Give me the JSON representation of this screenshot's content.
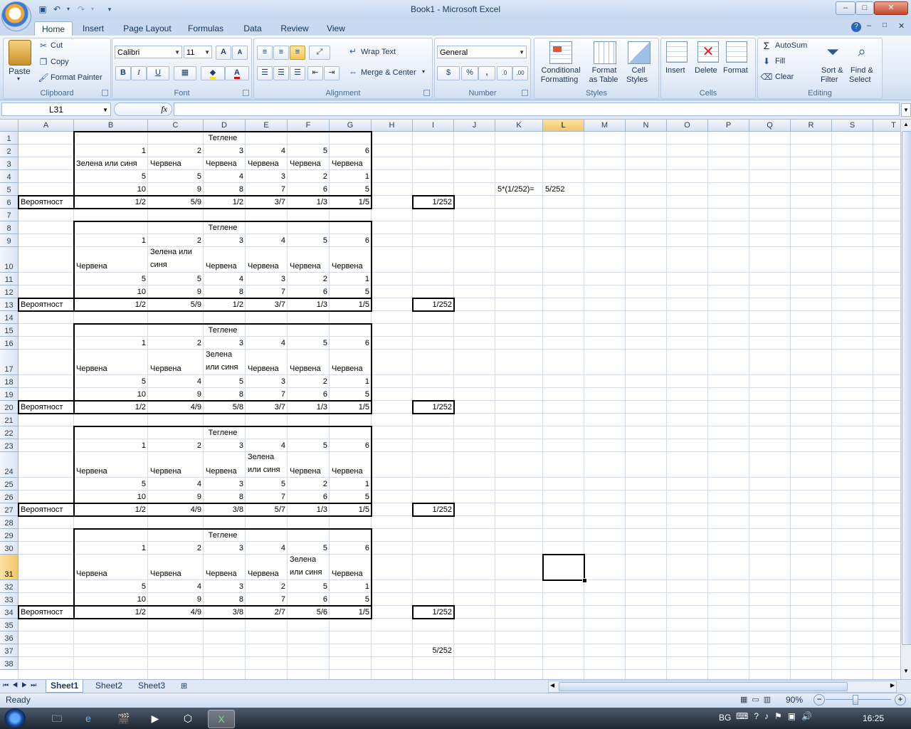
{
  "window": {
    "title": "Book1 - Microsoft Excel",
    "min": "–",
    "max": "□",
    "close": "✕"
  },
  "tabs": [
    "Home",
    "Insert",
    "Page Layout",
    "Formulas",
    "Data",
    "Review",
    "View"
  ],
  "ribbon": {
    "clipboard": {
      "label": "Clipboard",
      "paste": "Paste",
      "cut": "Cut",
      "copy": "Copy",
      "format_painter": "Format Painter"
    },
    "font": {
      "label": "Font",
      "name": "Calibri",
      "size": "11",
      "bold": "B",
      "italic": "I",
      "underline": "U",
      "grow": "A",
      "shrink": "A",
      "font_color_letter": "A"
    },
    "alignment": {
      "label": "Alignment",
      "wrap_text": "Wrap Text",
      "merge_center": "Merge & Center"
    },
    "number": {
      "label": "Number",
      "format": "General",
      "percent": "%",
      "comma": ",",
      "inc_dec": ".0",
      "dec_dec": ".00"
    },
    "styles": {
      "label": "Styles",
      "conditional_1": "Conditional",
      "conditional_2": "Formatting",
      "format_table_1": "Format",
      "format_table_2": "as Table",
      "cell_styles_1": "Cell",
      "cell_styles_2": "Styles"
    },
    "cells": {
      "label": "Cells",
      "insert": "Insert",
      "delete": "Delete",
      "format": "Format"
    },
    "editing": {
      "label": "Editing",
      "autosum": "AutoSum",
      "fill": "Fill",
      "clear": "Clear",
      "sort_1": "Sort &",
      "sort_2": "Filter",
      "find_1": "Find &",
      "find_2": "Select"
    }
  },
  "formula_bar": {
    "name_box": "L31",
    "fx": "fx",
    "formula": ""
  },
  "columns": [
    "A",
    "B",
    "C",
    "D",
    "E",
    "F",
    "G",
    "H",
    "I",
    "J",
    "K",
    "L",
    "M",
    "N",
    "O",
    "P",
    "Q",
    "R",
    "S",
    "T"
  ],
  "rows": [
    "1",
    "2",
    "3",
    "4",
    "5",
    "6",
    "7",
    "8",
    "9",
    "10",
    "11",
    "12",
    "13",
    "14",
    "15",
    "16",
    "17",
    "18",
    "19",
    "20",
    "21",
    "22",
    "23",
    "24",
    "25",
    "26",
    "27",
    "28",
    "29",
    "30",
    "31",
    "32",
    "33",
    "34",
    "35",
    "36",
    "37",
    "38"
  ],
  "cells": [
    {
      "r": 1,
      "c": "D",
      "v": "Теглене",
      "a": "c"
    },
    {
      "r": 2,
      "c": "B",
      "v": "1",
      "a": "r"
    },
    {
      "r": 2,
      "c": "C",
      "v": "2",
      "a": "r"
    },
    {
      "r": 2,
      "c": "D",
      "v": "3",
      "a": "r"
    },
    {
      "r": 2,
      "c": "E",
      "v": "4",
      "a": "r"
    },
    {
      "r": 2,
      "c": "F",
      "v": "5",
      "a": "r"
    },
    {
      "r": 2,
      "c": "G",
      "v": "6",
      "a": "r"
    },
    {
      "r": 3,
      "c": "B",
      "v": "Зелена или синя",
      "a": "l"
    },
    {
      "r": 3,
      "c": "C",
      "v": "Червена",
      "a": "l"
    },
    {
      "r": 3,
      "c": "D",
      "v": "Червена",
      "a": "l"
    },
    {
      "r": 3,
      "c": "E",
      "v": "Червена",
      "a": "l"
    },
    {
      "r": 3,
      "c": "F",
      "v": "Червена",
      "a": "l"
    },
    {
      "r": 3,
      "c": "G",
      "v": "Червена",
      "a": "l"
    },
    {
      "r": 4,
      "c": "B",
      "v": "5",
      "a": "r"
    },
    {
      "r": 4,
      "c": "C",
      "v": "5",
      "a": "r"
    },
    {
      "r": 4,
      "c": "D",
      "v": "4",
      "a": "r"
    },
    {
      "r": 4,
      "c": "E",
      "v": "3",
      "a": "r"
    },
    {
      "r": 4,
      "c": "F",
      "v": "2",
      "a": "r"
    },
    {
      "r": 4,
      "c": "G",
      "v": "1",
      "a": "r"
    },
    {
      "r": 5,
      "c": "B",
      "v": "10",
      "a": "r"
    },
    {
      "r": 5,
      "c": "C",
      "v": "9",
      "a": "r"
    },
    {
      "r": 5,
      "c": "D",
      "v": "8",
      "a": "r"
    },
    {
      "r": 5,
      "c": "E",
      "v": "7",
      "a": "r"
    },
    {
      "r": 5,
      "c": "F",
      "v": "6",
      "a": "r"
    },
    {
      "r": 5,
      "c": "G",
      "v": "5",
      "a": "r"
    },
    {
      "r": 5,
      "c": "K",
      "v": "5*(1/252)=",
      "a": "l"
    },
    {
      "r": 5,
      "c": "L",
      "v": "5/252",
      "a": "l"
    },
    {
      "r": 6,
      "c": "A",
      "v": "Вероятност",
      "a": "l"
    },
    {
      "r": 6,
      "c": "B",
      "v": "1/2",
      "a": "r"
    },
    {
      "r": 6,
      "c": "C",
      "v": "5/9",
      "a": "r"
    },
    {
      "r": 6,
      "c": "D",
      "v": "1/2",
      "a": "r"
    },
    {
      "r": 6,
      "c": "E",
      "v": "3/7",
      "a": "r"
    },
    {
      "r": 6,
      "c": "F",
      "v": "1/3",
      "a": "r"
    },
    {
      "r": 6,
      "c": "G",
      "v": "1/5",
      "a": "r"
    },
    {
      "r": 6,
      "c": "I",
      "v": "1/252",
      "a": "r"
    },
    {
      "r": 8,
      "c": "D",
      "v": "Теглене",
      "a": "c"
    },
    {
      "r": 9,
      "c": "B",
      "v": "1",
      "a": "r"
    },
    {
      "r": 9,
      "c": "C",
      "v": "2",
      "a": "r"
    },
    {
      "r": 9,
      "c": "D",
      "v": "3",
      "a": "r"
    },
    {
      "r": 9,
      "c": "E",
      "v": "4",
      "a": "r"
    },
    {
      "r": 9,
      "c": "F",
      "v": "5",
      "a": "r"
    },
    {
      "r": 9,
      "c": "G",
      "v": "6",
      "a": "r"
    },
    {
      "r": 10,
      "c": "B",
      "v": "Червена",
      "a": "l"
    },
    {
      "r": 10,
      "c": "C",
      "v": "Зелена или синя",
      "a": "w"
    },
    {
      "r": 10,
      "c": "D",
      "v": "Червена",
      "a": "l"
    },
    {
      "r": 10,
      "c": "E",
      "v": "Червена",
      "a": "l"
    },
    {
      "r": 10,
      "c": "F",
      "v": "Червена",
      "a": "l"
    },
    {
      "r": 10,
      "c": "G",
      "v": "Червена",
      "a": "l"
    },
    {
      "r": 11,
      "c": "B",
      "v": "5",
      "a": "r"
    },
    {
      "r": 11,
      "c": "C",
      "v": "5",
      "a": "r"
    },
    {
      "r": 11,
      "c": "D",
      "v": "4",
      "a": "r"
    },
    {
      "r": 11,
      "c": "E",
      "v": "3",
      "a": "r"
    },
    {
      "r": 11,
      "c": "F",
      "v": "2",
      "a": "r"
    },
    {
      "r": 11,
      "c": "G",
      "v": "1",
      "a": "r"
    },
    {
      "r": 12,
      "c": "B",
      "v": "10",
      "a": "r"
    },
    {
      "r": 12,
      "c": "C",
      "v": "9",
      "a": "r"
    },
    {
      "r": 12,
      "c": "D",
      "v": "8",
      "a": "r"
    },
    {
      "r": 12,
      "c": "E",
      "v": "7",
      "a": "r"
    },
    {
      "r": 12,
      "c": "F",
      "v": "6",
      "a": "r"
    },
    {
      "r": 12,
      "c": "G",
      "v": "5",
      "a": "r"
    },
    {
      "r": 13,
      "c": "A",
      "v": "Вероятност",
      "a": "l"
    },
    {
      "r": 13,
      "c": "B",
      "v": "1/2",
      "a": "r"
    },
    {
      "r": 13,
      "c": "C",
      "v": "5/9",
      "a": "r"
    },
    {
      "r": 13,
      "c": "D",
      "v": "1/2",
      "a": "r"
    },
    {
      "r": 13,
      "c": "E",
      "v": "3/7",
      "a": "r"
    },
    {
      "r": 13,
      "c": "F",
      "v": "1/3",
      "a": "r"
    },
    {
      "r": 13,
      "c": "G",
      "v": "1/5",
      "a": "r"
    },
    {
      "r": 13,
      "c": "I",
      "v": "1/252",
      "a": "r"
    },
    {
      "r": 15,
      "c": "D",
      "v": "Теглене",
      "a": "c"
    },
    {
      "r": 16,
      "c": "B",
      "v": "1",
      "a": "r"
    },
    {
      "r": 16,
      "c": "C",
      "v": "2",
      "a": "r"
    },
    {
      "r": 16,
      "c": "D",
      "v": "3",
      "a": "r"
    },
    {
      "r": 16,
      "c": "E",
      "v": "4",
      "a": "r"
    },
    {
      "r": 16,
      "c": "F",
      "v": "5",
      "a": "r"
    },
    {
      "r": 16,
      "c": "G",
      "v": "6",
      "a": "r"
    },
    {
      "r": 17,
      "c": "B",
      "v": "Червена",
      "a": "l"
    },
    {
      "r": 17,
      "c": "C",
      "v": "Червена",
      "a": "l"
    },
    {
      "r": 17,
      "c": "D",
      "v": "Зелена или синя",
      "a": "w"
    },
    {
      "r": 17,
      "c": "E",
      "v": "Червена",
      "a": "l"
    },
    {
      "r": 17,
      "c": "F",
      "v": "Червена",
      "a": "l"
    },
    {
      "r": 17,
      "c": "G",
      "v": "Червена",
      "a": "l"
    },
    {
      "r": 18,
      "c": "B",
      "v": "5",
      "a": "r"
    },
    {
      "r": 18,
      "c": "C",
      "v": "4",
      "a": "r"
    },
    {
      "r": 18,
      "c": "D",
      "v": "5",
      "a": "r"
    },
    {
      "r": 18,
      "c": "E",
      "v": "3",
      "a": "r"
    },
    {
      "r": 18,
      "c": "F",
      "v": "2",
      "a": "r"
    },
    {
      "r": 18,
      "c": "G",
      "v": "1",
      "a": "r"
    },
    {
      "r": 19,
      "c": "B",
      "v": "10",
      "a": "r"
    },
    {
      "r": 19,
      "c": "C",
      "v": "9",
      "a": "r"
    },
    {
      "r": 19,
      "c": "D",
      "v": "8",
      "a": "r"
    },
    {
      "r": 19,
      "c": "E",
      "v": "7",
      "a": "r"
    },
    {
      "r": 19,
      "c": "F",
      "v": "6",
      "a": "r"
    },
    {
      "r": 19,
      "c": "G",
      "v": "5",
      "a": "r"
    },
    {
      "r": 20,
      "c": "A",
      "v": "Вероятност",
      "a": "l"
    },
    {
      "r": 20,
      "c": "B",
      "v": "1/2",
      "a": "r"
    },
    {
      "r": 20,
      "c": "C",
      "v": "4/9",
      "a": "r"
    },
    {
      "r": 20,
      "c": "D",
      "v": "5/8",
      "a": "r"
    },
    {
      "r": 20,
      "c": "E",
      "v": "3/7",
      "a": "r"
    },
    {
      "r": 20,
      "c": "F",
      "v": "1/3",
      "a": "r"
    },
    {
      "r": 20,
      "c": "G",
      "v": "1/5",
      "a": "r"
    },
    {
      "r": 20,
      "c": "I",
      "v": "1/252",
      "a": "r"
    },
    {
      "r": 22,
      "c": "D",
      "v": "Теглене",
      "a": "c"
    },
    {
      "r": 23,
      "c": "B",
      "v": "1",
      "a": "r"
    },
    {
      "r": 23,
      "c": "C",
      "v": "2",
      "a": "r"
    },
    {
      "r": 23,
      "c": "D",
      "v": "3",
      "a": "r"
    },
    {
      "r": 23,
      "c": "E",
      "v": "4",
      "a": "r"
    },
    {
      "r": 23,
      "c": "F",
      "v": "5",
      "a": "r"
    },
    {
      "r": 23,
      "c": "G",
      "v": "6",
      "a": "r"
    },
    {
      "r": 24,
      "c": "B",
      "v": "Червена",
      "a": "l"
    },
    {
      "r": 24,
      "c": "C",
      "v": "Червена",
      "a": "l"
    },
    {
      "r": 24,
      "c": "D",
      "v": "Червена",
      "a": "l"
    },
    {
      "r": 24,
      "c": "E",
      "v": "Зелена или синя",
      "a": "w"
    },
    {
      "r": 24,
      "c": "F",
      "v": "Червена",
      "a": "l"
    },
    {
      "r": 24,
      "c": "G",
      "v": "Червена",
      "a": "l"
    },
    {
      "r": 25,
      "c": "B",
      "v": "5",
      "a": "r"
    },
    {
      "r": 25,
      "c": "C",
      "v": "4",
      "a": "r"
    },
    {
      "r": 25,
      "c": "D",
      "v": "3",
      "a": "r"
    },
    {
      "r": 25,
      "c": "E",
      "v": "5",
      "a": "r"
    },
    {
      "r": 25,
      "c": "F",
      "v": "2",
      "a": "r"
    },
    {
      "r": 25,
      "c": "G",
      "v": "1",
      "a": "r"
    },
    {
      "r": 26,
      "c": "B",
      "v": "10",
      "a": "r"
    },
    {
      "r": 26,
      "c": "C",
      "v": "9",
      "a": "r"
    },
    {
      "r": 26,
      "c": "D",
      "v": "8",
      "a": "r"
    },
    {
      "r": 26,
      "c": "E",
      "v": "7",
      "a": "r"
    },
    {
      "r": 26,
      "c": "F",
      "v": "6",
      "a": "r"
    },
    {
      "r": 26,
      "c": "G",
      "v": "5",
      "a": "r"
    },
    {
      "r": 27,
      "c": "A",
      "v": "Вероятност",
      "a": "l"
    },
    {
      "r": 27,
      "c": "B",
      "v": "1/2",
      "a": "r"
    },
    {
      "r": 27,
      "c": "C",
      "v": "4/9",
      "a": "r"
    },
    {
      "r": 27,
      "c": "D",
      "v": "3/8",
      "a": "r"
    },
    {
      "r": 27,
      "c": "E",
      "v": "5/7",
      "a": "r"
    },
    {
      "r": 27,
      "c": "F",
      "v": "1/3",
      "a": "r"
    },
    {
      "r": 27,
      "c": "G",
      "v": "1/5",
      "a": "r"
    },
    {
      "r": 27,
      "c": "I",
      "v": "1/252",
      "a": "r"
    },
    {
      "r": 29,
      "c": "D",
      "v": "Теглене",
      "a": "c"
    },
    {
      "r": 30,
      "c": "B",
      "v": "1",
      "a": "r"
    },
    {
      "r": 30,
      "c": "C",
      "v": "2",
      "a": "r"
    },
    {
      "r": 30,
      "c": "D",
      "v": "3",
      "a": "r"
    },
    {
      "r": 30,
      "c": "E",
      "v": "4",
      "a": "r"
    },
    {
      "r": 30,
      "c": "F",
      "v": "5",
      "a": "r"
    },
    {
      "r": 30,
      "c": "G",
      "v": "6",
      "a": "r"
    },
    {
      "r": 31,
      "c": "B",
      "v": "Червена",
      "a": "l"
    },
    {
      "r": 31,
      "c": "C",
      "v": "Червена",
      "a": "l"
    },
    {
      "r": 31,
      "c": "D",
      "v": "Червена",
      "a": "l"
    },
    {
      "r": 31,
      "c": "E",
      "v": "Червена",
      "a": "l"
    },
    {
      "r": 31,
      "c": "F",
      "v": "Зелена или синя",
      "a": "w"
    },
    {
      "r": 31,
      "c": "G",
      "v": "Червена",
      "a": "l"
    },
    {
      "r": 32,
      "c": "B",
      "v": "5",
      "a": "r"
    },
    {
      "r": 32,
      "c": "C",
      "v": "4",
      "a": "r"
    },
    {
      "r": 32,
      "c": "D",
      "v": "3",
      "a": "r"
    },
    {
      "r": 32,
      "c": "E",
      "v": "2",
      "a": "r"
    },
    {
      "r": 32,
      "c": "F",
      "v": "5",
      "a": "r"
    },
    {
      "r": 32,
      "c": "G",
      "v": "1",
      "a": "r"
    },
    {
      "r": 33,
      "c": "B",
      "v": "10",
      "a": "r"
    },
    {
      "r": 33,
      "c": "C",
      "v": "9",
      "a": "r"
    },
    {
      "r": 33,
      "c": "D",
      "v": "8",
      "a": "r"
    },
    {
      "r": 33,
      "c": "E",
      "v": "7",
      "a": "r"
    },
    {
      "r": 33,
      "c": "F",
      "v": "6",
      "a": "r"
    },
    {
      "r": 33,
      "c": "G",
      "v": "5",
      "a": "r"
    },
    {
      "r": 34,
      "c": "A",
      "v": "Вероятност",
      "a": "l"
    },
    {
      "r": 34,
      "c": "B",
      "v": "1/2",
      "a": "r"
    },
    {
      "r": 34,
      "c": "C",
      "v": "4/9",
      "a": "r"
    },
    {
      "r": 34,
      "c": "D",
      "v": "3/8",
      "a": "r"
    },
    {
      "r": 34,
      "c": "E",
      "v": "2/7",
      "a": "r"
    },
    {
      "r": 34,
      "c": "F",
      "v": "5/6",
      "a": "r"
    },
    {
      "r": 34,
      "c": "G",
      "v": "1/5",
      "a": "r"
    },
    {
      "r": 34,
      "c": "I",
      "v": "1/252",
      "a": "r"
    },
    {
      "r": 37,
      "c": "I",
      "v": "5/252",
      "a": "r"
    }
  ],
  "selected": {
    "col": "L",
    "row": 31
  },
  "sheets": [
    "Sheet1",
    "Sheet2",
    "Sheet3"
  ],
  "status": {
    "ready": "Ready",
    "zoom": "90%",
    "zoom_minus": "−",
    "zoom_plus": "+"
  },
  "taskbar": {
    "lang": "BG",
    "time": "16:25"
  },
  "colors": {
    "accent": "#c9daf0",
    "selected_header": "#f3c766"
  }
}
